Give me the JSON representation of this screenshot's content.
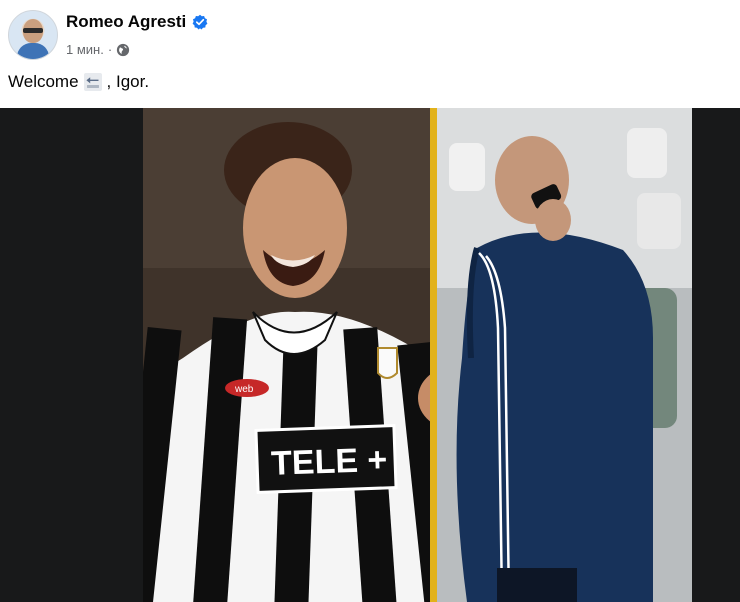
{
  "post": {
    "author": "Romeo Agresti",
    "time": "1 мин.",
    "separator": "·",
    "text_before": "Welcome",
    "text_after": ", Igor.",
    "emoji": "back-arrow-emoji"
  },
  "icons": {
    "verified": "verified-badge-icon",
    "audience": "globe-icon"
  },
  "photo": {
    "jersey_text": "TELE +",
    "sponsor_patch": "web"
  },
  "colors": {
    "accent_blue": "#1877f2",
    "divider_yellow": "#e2b21b",
    "meta_gray": "#65676b"
  }
}
